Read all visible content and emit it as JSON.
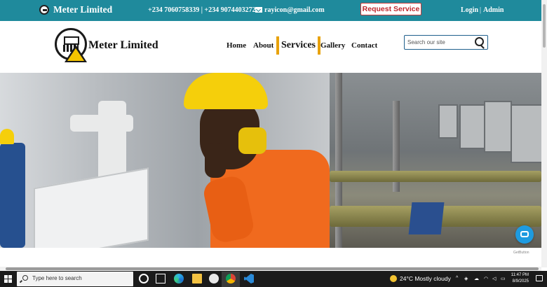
{
  "topbar": {
    "brand": "Meter Limited",
    "phone": "+234 7060758339 | +234 9074403272",
    "email": "rayicon@gmail.com",
    "request_service": "Request Service",
    "login": "Login",
    "separator": "|",
    "admin": "Admin"
  },
  "header": {
    "brand": "Meter Limited",
    "nav": {
      "home": "Home",
      "about": "About",
      "services": "Services",
      "gallery": "Gallery",
      "contact": "Contact"
    },
    "search_placeholder": "Search our site"
  },
  "hero": {
    "getbutton_label": "GetButton"
  },
  "taskbar": {
    "search_placeholder": "Type here to search",
    "weather": "24°C  Mostly cloudy",
    "time": "11:47 PM",
    "date": "8/9/2025"
  },
  "colors": {
    "topbar": "#1f8a9c",
    "request_text": "#c0262c",
    "nav_accent": "#e8a20c",
    "search_border": "#1f5f8c",
    "chat": "#1e9be0"
  }
}
